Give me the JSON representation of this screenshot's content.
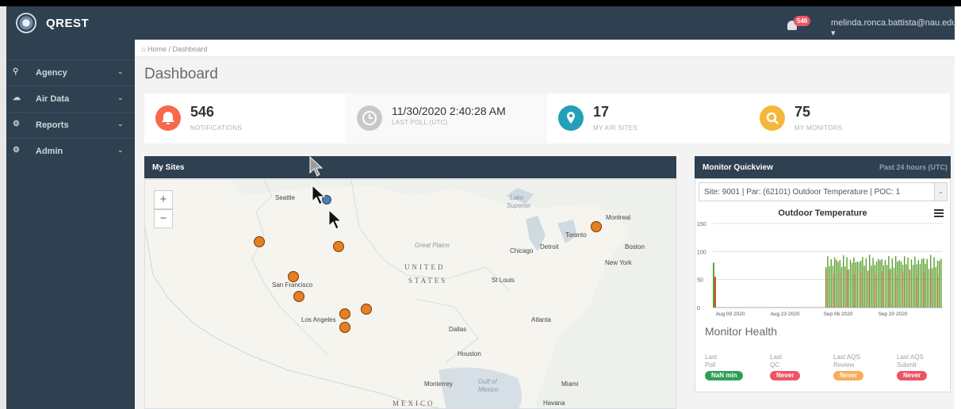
{
  "app": {
    "name": "QREST"
  },
  "header": {
    "notification_count": "546",
    "user_email": "melinda.ronca.battista@nau.edu ▾"
  },
  "sidebar": {
    "items": [
      {
        "label": "Agency",
        "icon": "map-marker-icon"
      },
      {
        "label": "Air Data",
        "icon": "cloud-icon"
      },
      {
        "label": "Reports",
        "icon": "reports-icon"
      },
      {
        "label": "Admin",
        "icon": "cogs-icon"
      }
    ]
  },
  "breadcrumb": {
    "home": "Home",
    "separator": "/",
    "current": "Dashboard"
  },
  "page": {
    "title": "Dashboard"
  },
  "stats": [
    {
      "value": "546",
      "label": "NOTIFICATIONS",
      "color": "#f8684d",
      "icon": "bell-icon"
    },
    {
      "value": "11/30/2020 2:40:28 AM",
      "label": "LAST POLL (UTC)",
      "color": "#c8c8c8",
      "icon": "clock-icon"
    },
    {
      "value": "17",
      "label": "MY AIR SITES",
      "color": "#23a0b7",
      "icon": "map-marker-icon"
    },
    {
      "value": "75",
      "label": "MY MONITORS",
      "color": "#f5b73b",
      "icon": "search-icon"
    }
  ],
  "my_sites": {
    "title": "My Sites",
    "labels": {
      "seattle": "Seattle",
      "montreal": "Montreal",
      "toronto": "Toronto",
      "boston": "Boston",
      "new_york": "New York",
      "detroit": "Detroit",
      "chicago": "Chicago",
      "great_plains": "Great Plains",
      "united": "UNITED",
      "states": "STATES",
      "st_louis": "St Louis",
      "san_francisco": "San Francisco",
      "los_angeles": "Los Angeles",
      "dallas": "Dallas",
      "atlanta": "Atlanta",
      "houston": "Houston",
      "monterrey": "Monterrey",
      "miami": "Miami",
      "gulf": "Gulf of",
      "mexico_water": "Mexico",
      "havana": "Havana",
      "mexico": "MEXICO",
      "lake": "Lake",
      "superior": "Superior"
    }
  },
  "quickview": {
    "title": "Monitor Quickview",
    "subtitle": "Past 24 hours (UTC)",
    "selected_monitor": "Site: 9001 | Par: (62101) Outdoor Temperature | POC: 1"
  },
  "chart_data": {
    "type": "bar",
    "title": "Outdoor Temperature",
    "xlabel": "",
    "ylabel": "",
    "ylim": [
      0,
      150
    ],
    "y_ticks": [
      0,
      50,
      100,
      150
    ],
    "x_ticks": [
      "Aug 09 2020",
      "Aug 23 2020",
      "Sep 06 2020",
      "Sep 20 2020"
    ],
    "series_colors": [
      "#5aa02c",
      "#d34d2c"
    ],
    "grid": true,
    "legend": "none"
  },
  "health": {
    "title": "Monitor Health",
    "items": [
      {
        "line1": "Last",
        "line2": "Poll",
        "status": "NaN min",
        "color": "#2e9f57"
      },
      {
        "line1": "Last",
        "line2": "QC",
        "status": "Never",
        "color": "#ed5565"
      },
      {
        "line1": "Last AQS",
        "line2": "Review",
        "status": "Never",
        "color": "#f8ac59"
      },
      {
        "line1": "Last AQS",
        "line2": "Submit",
        "status": "Never",
        "color": "#ed5565"
      }
    ]
  }
}
